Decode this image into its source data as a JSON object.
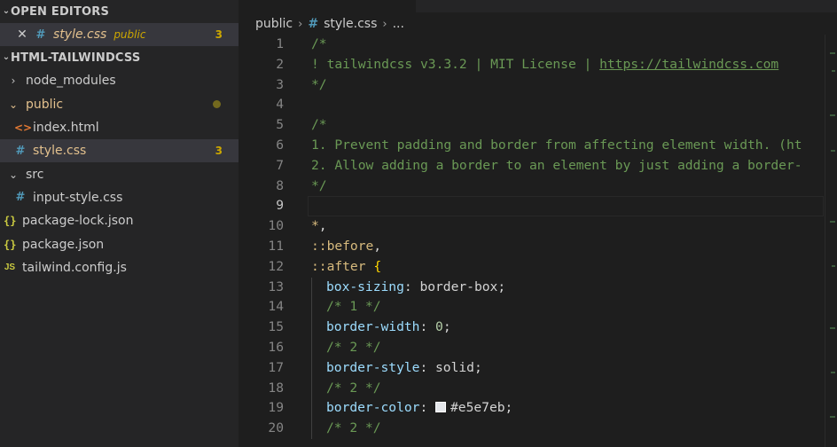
{
  "sidebar": {
    "open_editors_header": "OPEN EDITORS",
    "open_editors": [
      {
        "name": "style.css",
        "desc": "public",
        "badge": "3"
      }
    ],
    "workspace_header": "HTML-TAILWINDCSS",
    "tree": [
      {
        "label": "node_modules",
        "type": "folder-collapsed"
      },
      {
        "label": "public",
        "type": "folder-open",
        "modified": true
      },
      {
        "label": "index.html",
        "type": "html"
      },
      {
        "label": "style.css",
        "type": "css",
        "badge": "3",
        "selected": true
      },
      {
        "label": "src",
        "type": "folder-open"
      },
      {
        "label": "input-style.css",
        "type": "css"
      },
      {
        "label": "package-lock.json",
        "type": "json"
      },
      {
        "label": "package.json",
        "type": "json"
      },
      {
        "label": "tailwind.config.js",
        "type": "js"
      }
    ],
    "icons": {
      "css": "#",
      "html": "<>",
      "json": "{}",
      "js": "JS",
      "chevron_right": "›",
      "chevron_down": "⌄",
      "close": "✕"
    }
  },
  "breadcrumb": {
    "folder": "public",
    "file": "style.css",
    "more": "..."
  },
  "code": {
    "line_numbers": [
      "1",
      "2",
      "3",
      "4",
      "5",
      "6",
      "7",
      "8",
      "9",
      "10",
      "11",
      "12",
      "13",
      "14",
      "15",
      "16",
      "17",
      "18",
      "19",
      "20"
    ],
    "lines": {
      "l1": "/*",
      "l2_a": "! tailwindcss v3.3.2 | MIT License | ",
      "l2_link": "https://tailwindcss.com",
      "l3": "*/",
      "l5": "/*",
      "l6": "1. Prevent padding and border from affecting element width. (ht",
      "l7": "2. Allow adding a border to an element by just adding a border-",
      "l8": "*/",
      "l10_sel": "*",
      "l10_punct": ",",
      "l11_sel": "::before",
      "l11_punct": ",",
      "l12_sel": "::after",
      "l12_brace": "{",
      "l13_prop": "box-sizing",
      "l13_val": "border-box;",
      "l14": "/* 1 */",
      "l15_prop": "border-width",
      "l15_num": "0",
      "l16": "/* 2 */",
      "l17_prop": "border-style",
      "l17_val": "solid;",
      "l18": "/* 2 */",
      "l19_prop": "border-color",
      "l19_val": "#e5e7eb;",
      "l20": "/* 2 */"
    }
  },
  "colors": {
    "comment": "#6a9955",
    "selector": "#d7ba7d",
    "property": "#9cdcfe",
    "number": "#b5cea8",
    "badge": "#cca700",
    "modified": "#e2c08d",
    "swatch": "#e5e7eb"
  }
}
